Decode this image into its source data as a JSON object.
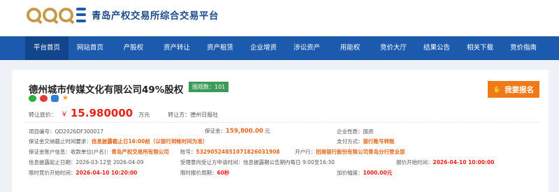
{
  "header": {
    "logo_text": "青岛产权交易所综合交易平台"
  },
  "nav": {
    "items": [
      {
        "label": "平台首页",
        "active": true
      },
      {
        "label": "网站首页"
      },
      {
        "label": "产股权"
      },
      {
        "label": "资产转让"
      },
      {
        "label": "资产租赁"
      },
      {
        "label": "企业增资"
      },
      {
        "label": "涉讼资产"
      },
      {
        "label": "用能权"
      },
      {
        "label": "竞价大厅"
      },
      {
        "label": "结果公告"
      },
      {
        "label": "相关下载"
      },
      {
        "label": "竞价指南"
      }
    ]
  },
  "project": {
    "title": "德州城市传媒文化有限公司49%股权",
    "views": "围观数：101",
    "apply_label": "我要报名",
    "price_label": "转让底价：",
    "currency": "￥",
    "price": "15.980000",
    "price_unit": "万元",
    "transferor": "转让方：德州日报社",
    "fields": {
      "project_no_label": "项目编号：",
      "project_no": "QD2026DF300017",
      "deposit_label": "保证金：",
      "deposit_value": "159,800.00",
      "deposit_unit": "元",
      "enterprise_label": "企业性质：",
      "enterprise_value": "国资",
      "deposit_deadline_label": "保证金交纳截止时间要求：",
      "deposit_deadline_value": "信息披露截止日16:00前（以银行到帐时间为准）",
      "payment_label": "支付方式：",
      "payment_value": "银行账号转账",
      "account_name_label": "保证金账户信息：收款单位(户名)：",
      "account_name_value": "青岛产权交易所有限公司",
      "account_no_label": "账号：",
      "account_no_value": "532905248510718260319​08",
      "bank_label": "开户行：",
      "bank_value": "招商银行股份有限公司青岛分行营业部",
      "disclosure_label": "信息披露起止日期：",
      "disclosure_value": "2026-03-12至 2026-04-09",
      "consult_label": "受理意向受让方申请时间：",
      "consult_value": "信息披露期公告期内每日 9:00至16:30",
      "bid_start_label": "报价开始时间：",
      "bid_start_value": "2026-04-10 10:00:00",
      "limit_start_label": "限时竞价开始时间：",
      "limit_start_value": "2026-04-10 10:20:00",
      "limit_period_label": "限时报价周期：",
      "limit_period_value": "60秒",
      "increment_label": "加价幅度：",
      "increment_value": "1000.00元"
    }
  }
}
